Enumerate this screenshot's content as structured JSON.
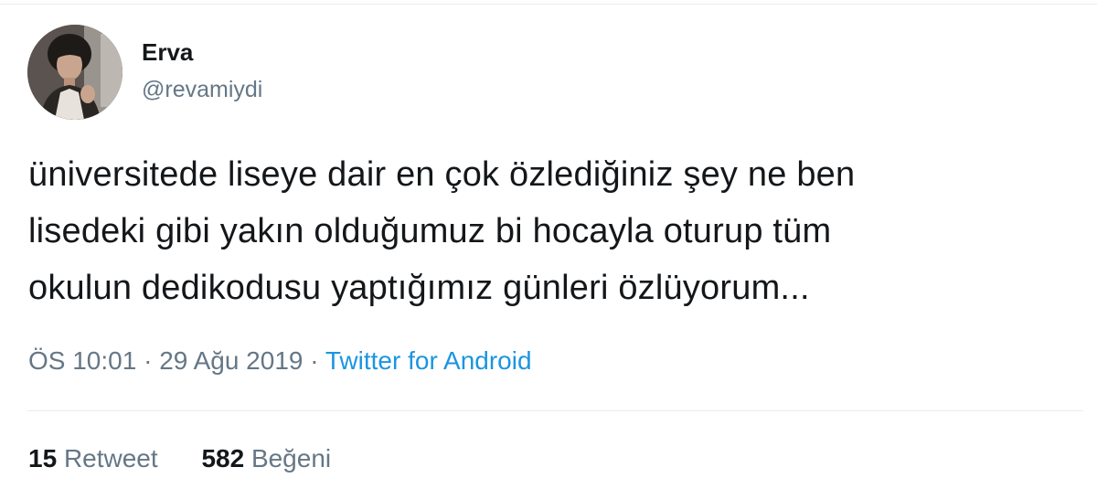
{
  "tweet": {
    "author": {
      "name": "Erva",
      "handle": "@revamiydi",
      "avatar_icon": "profile-photo"
    },
    "text_lines": [
      "üniversitede liseye dair en çok özlediğiniz şey ne ben",
      "lisedeki gibi yakın olduğumuz bi hocayla oturup tüm",
      "okulun dedikodusu yaptığımız günleri özlüyorum..."
    ],
    "meta": {
      "time": "ÖS 10:01",
      "separator": "·",
      "date": "29 Ağu 2019",
      "source": "Twitter for Android"
    },
    "stats": {
      "retweet_count": "15",
      "retweet_label": "Retweet",
      "like_count": "582",
      "like_label": "Beğeni"
    }
  },
  "colors": {
    "text": "#14171a",
    "secondary": "#657786",
    "link": "#1b95e0",
    "border": "#e6ecf0"
  }
}
